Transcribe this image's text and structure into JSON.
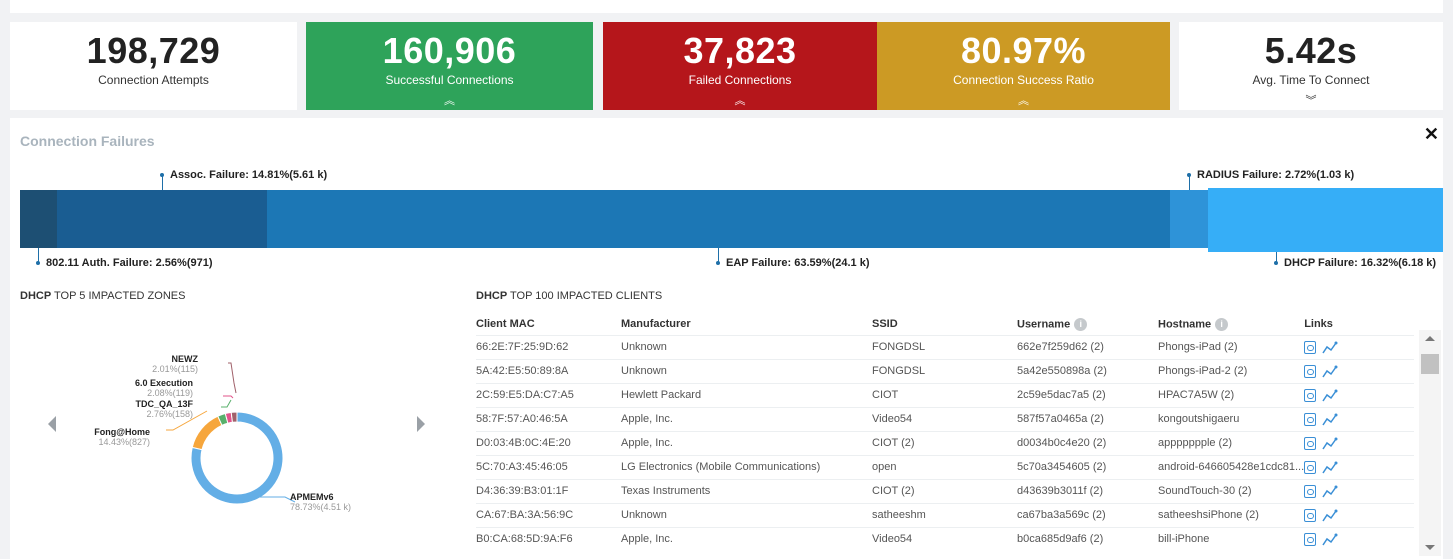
{
  "metrics": [
    {
      "value": "198,729",
      "label": "Connection Attempts",
      "chevron": "",
      "color": "#ffffff"
    },
    {
      "value": "160,906",
      "label": "Successful Connections",
      "chevron": "︽",
      "color": "#2ea35a"
    },
    {
      "value": "37,823",
      "label": "Failed Connections",
      "chevron": "︽",
      "color": "#b5161b"
    },
    {
      "value": "80.97%",
      "label": "Connection Success Ratio",
      "chevron": "︽",
      "color": "#cc9a24"
    },
    {
      "value": "5.42s",
      "label": "Avg. Time To Connect",
      "chevron": "︾",
      "color": "#ffffff"
    }
  ],
  "failures": {
    "title": "Connection Failures",
    "close_icon": "close-icon",
    "segments": [
      {
        "label": "802.11 Auth. Failure: 2.56%(971)",
        "percent": 2.56,
        "color": "#1d4f73"
      },
      {
        "label": "Assoc. Failure: 14.81%(5.61 k)",
        "percent": 14.81,
        "color": "#1a5d92"
      },
      {
        "label": "EAP Failure: 63.59%(24.1 k)",
        "percent": 63.59,
        "color": "#1c77b5"
      },
      {
        "label": "RADIUS Failure: 2.72%(1.03 k)",
        "percent": 2.72,
        "color": "#2e93d8"
      },
      {
        "label": "DHCP Failure: 16.32%(6.18 k)",
        "percent": 16.32,
        "color": "#36aef7"
      }
    ]
  },
  "zones": {
    "title_bold": "DHCP",
    "title_rest": " TOP 5 IMPACTED ZONES",
    "items": [
      {
        "name": "NEWZ",
        "value": "2.01%(115)",
        "percent": 2.01,
        "color": "#a0616a"
      },
      {
        "name": "6.0 Execution",
        "value": "2.08%(119)",
        "percent": 2.08,
        "color": "#e2538a"
      },
      {
        "name": "TDC_QA_13F",
        "value": "2.76%(158)",
        "percent": 2.76,
        "color": "#58b06b"
      },
      {
        "name": "Fong@Home",
        "value": "14.43%(827)",
        "percent": 14.43,
        "color": "#f6a63c"
      },
      {
        "name": "APMEMv6",
        "value": "78.73%(4.51 k)",
        "percent": 78.73,
        "color": "#63aee6"
      }
    ]
  },
  "clients": {
    "title_bold": "DHCP",
    "title_rest": " TOP 100 IMPACTED CLIENTS",
    "columns": [
      "Client MAC",
      "Manufacturer",
      "SSID",
      "Username",
      "Hostname",
      "Links"
    ],
    "rows": [
      [
        "66:2E:7F:25:9D:62",
        "Unknown",
        "FONGDSL",
        "662e7f259d62 (2)",
        "Phongs-iPad (2)"
      ],
      [
        "5A:42:E5:50:89:8A",
        "Unknown",
        "FONGDSL",
        "5a42e550898a (2)",
        "Phongs-iPad-2 (2)"
      ],
      [
        "2C:59:E5:DA:C7:A5",
        "Hewlett Packard",
        "CIOT",
        "2c59e5dac7a5 (2)",
        "HPAC7A5W (2)"
      ],
      [
        "58:7F:57:A0:46:5A",
        "Apple, Inc.",
        "Video54",
        "587f57a0465a (2)",
        "kongoutshigaeru"
      ],
      [
        "D0:03:4B:0C:4E:20",
        "Apple, Inc.",
        "CIOT (2)",
        "d0034b0c4e20 (2)",
        "appppppple (2)"
      ],
      [
        "5C:70:A3:45:46:05",
        "LG Electronics (Mobile Communications)",
        "open",
        "5c70a3454605 (2)",
        "android-646605428e1cdc81..."
      ],
      [
        "D4:36:39:B3:01:1F",
        "Texas Instruments",
        "CIOT (2)",
        "d43639b3011f (2)",
        "SoundTouch-30 (2)"
      ],
      [
        "CA:67:BA:3A:56:9C",
        "Unknown",
        "satheeshm",
        "ca67ba3a569c (2)",
        "satheeshsiPhone (2)"
      ],
      [
        "B0:CA:68:5D:9A:F6",
        "Apple, Inc.",
        "Video54",
        "b0ca685d9af6 (2)",
        "bill-iPhone"
      ]
    ]
  }
}
